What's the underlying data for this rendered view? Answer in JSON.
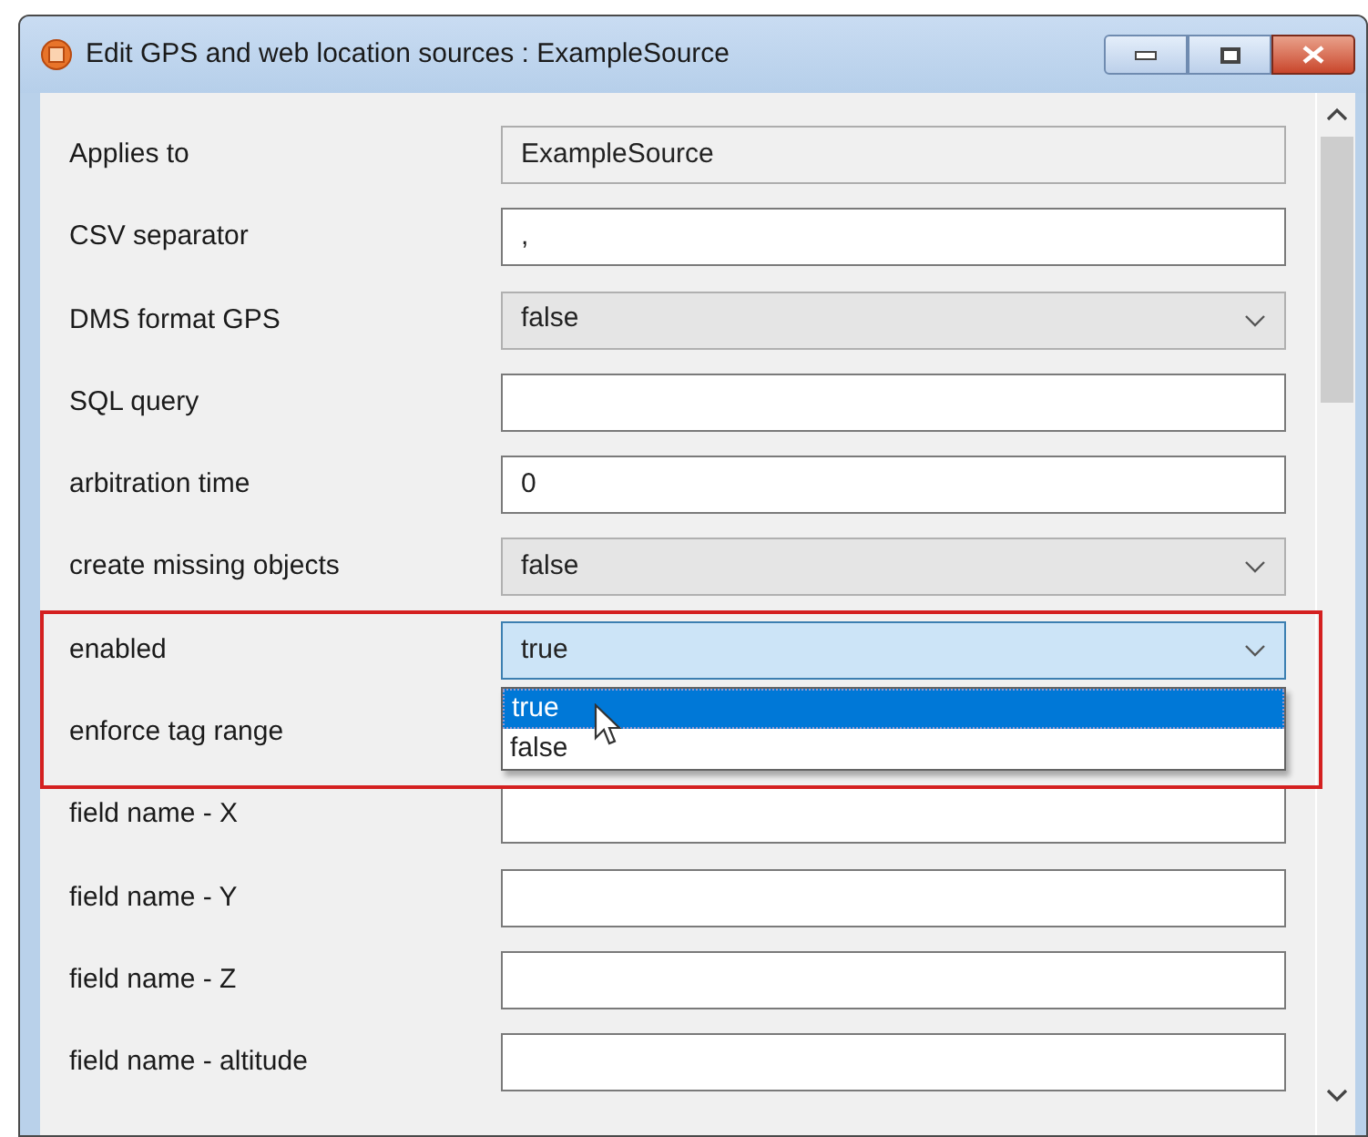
{
  "window": {
    "title": "Edit GPS and web location sources : ExampleSource"
  },
  "rows": [
    {
      "label": "Applies to",
      "kind": "readonly",
      "value": "ExampleSource"
    },
    {
      "label": "CSV separator",
      "kind": "text",
      "value": ","
    },
    {
      "label": "DMS format GPS",
      "kind": "select",
      "value": "false",
      "open": false
    },
    {
      "label": "SQL query",
      "kind": "text"
    },
    {
      "label": "arbitration time",
      "kind": "text",
      "value": "0"
    },
    {
      "label": "create missing objects",
      "kind": "select",
      "value": "false",
      "open": false
    },
    {
      "label": "enabled",
      "kind": "select",
      "value": "true",
      "open": true,
      "options": [
        {
          "label": "true",
          "selected": true
        },
        {
          "label": "false",
          "selected": false
        }
      ]
    },
    {
      "label": "enforce tag range",
      "kind": "hidden"
    },
    {
      "label": "field name - X",
      "kind": "text"
    },
    {
      "label": "field name - Y",
      "kind": "text"
    },
    {
      "label": "field name - Z",
      "kind": "text"
    },
    {
      "label": "field name - altitude",
      "kind": "text"
    }
  ]
}
